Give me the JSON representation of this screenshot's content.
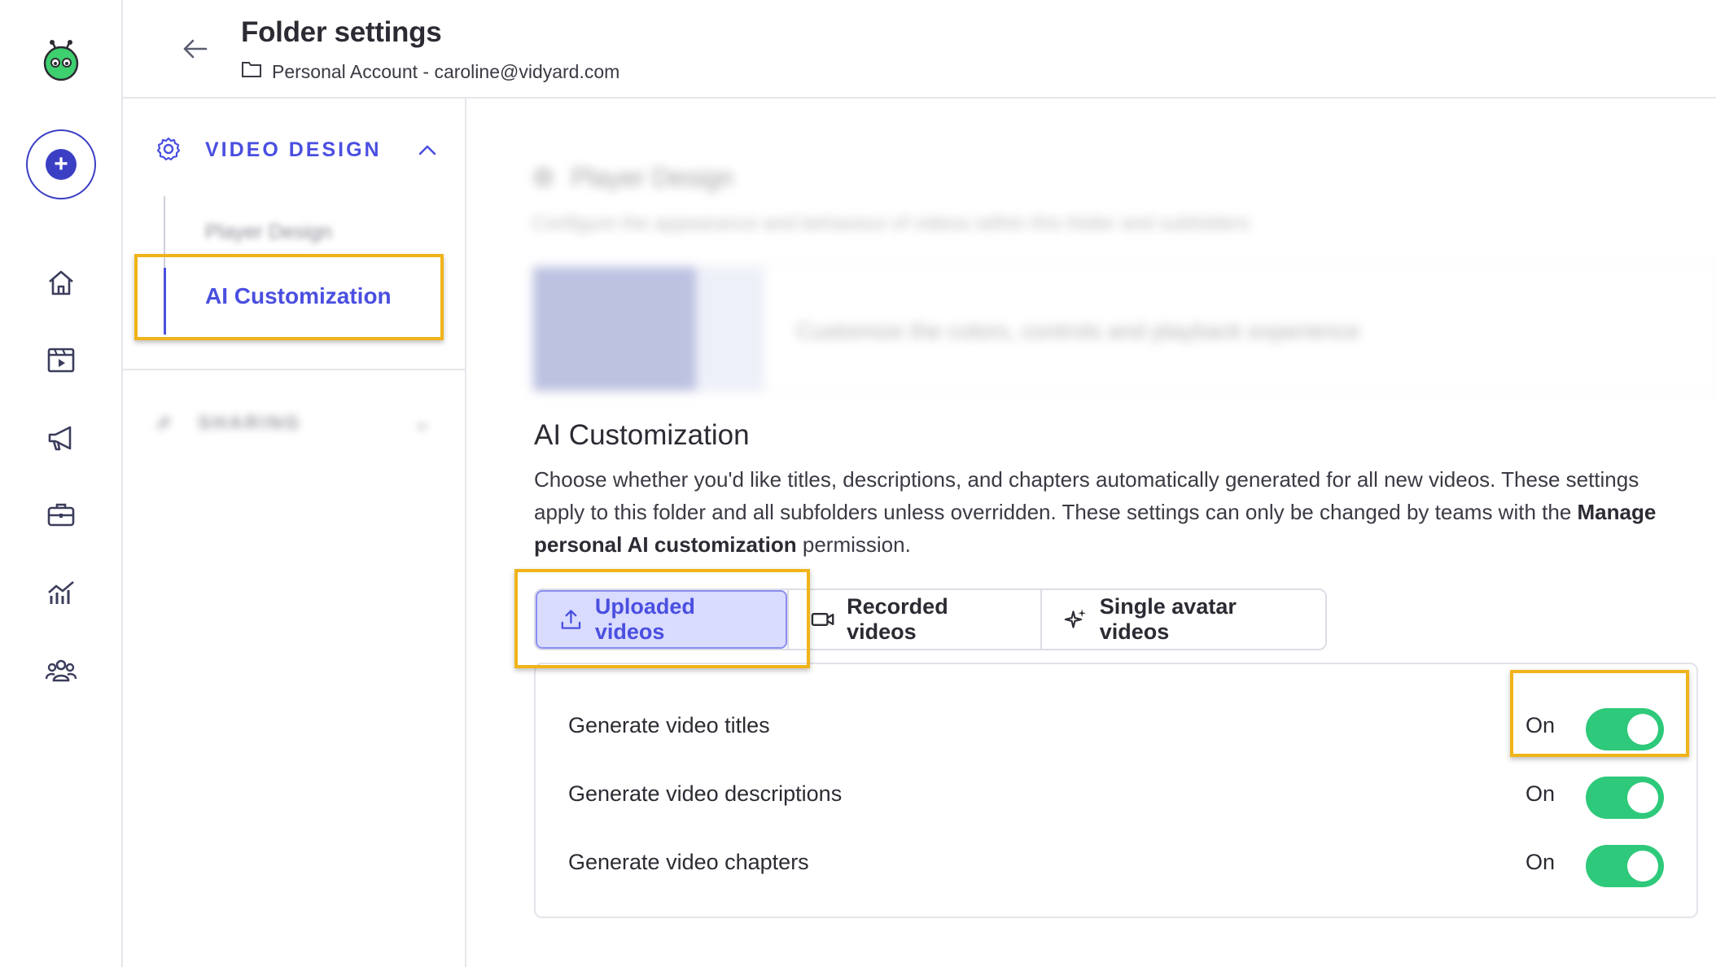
{
  "header": {
    "title": "Folder settings",
    "breadcrumb": "Personal Account - caroline@vidyard.com"
  },
  "rail": {
    "icons": [
      "vidyard-logo-icon",
      "create-plus-icon",
      "home-icon",
      "video-library-icon",
      "megaphone-icon",
      "briefcase-icon",
      "analytics-icon",
      "team-icon"
    ]
  },
  "nav": {
    "section_label": "VIDEO DESIGN",
    "items": [
      {
        "label": "Player Design"
      },
      {
        "label": "AI Customization"
      }
    ],
    "sharing_label": "SHARING"
  },
  "main": {
    "player_design": {
      "title": "Player Design",
      "description": "Configure the appearance and behaviour of videos within this folder and subfolders",
      "card_text": "Customize the colors, controls and playback experience"
    },
    "ai": {
      "title": "AI Customization",
      "desc_part1": "Choose whether you'd like titles, descriptions, and chapters automatically generated for all new videos. These settings apply to this folder and all subfolders unless overridden. These settings can only be changed by teams with the ",
      "desc_bold": "Manage personal AI customization",
      "desc_part2": " permission."
    },
    "tabs": [
      {
        "label": "Uploaded videos",
        "active": true
      },
      {
        "label": "Recorded videos",
        "active": false
      },
      {
        "label": "Single avatar videos",
        "active": false
      }
    ],
    "toggles": [
      {
        "label": "Generate video titles",
        "state": "On"
      },
      {
        "label": "Generate video descriptions",
        "state": "On"
      },
      {
        "label": "Generate video chapters",
        "state": "On"
      }
    ]
  },
  "colors": {
    "accent": "#4a4fe0",
    "toggle_on": "#2ec97a",
    "highlight": "#f0b41a"
  }
}
